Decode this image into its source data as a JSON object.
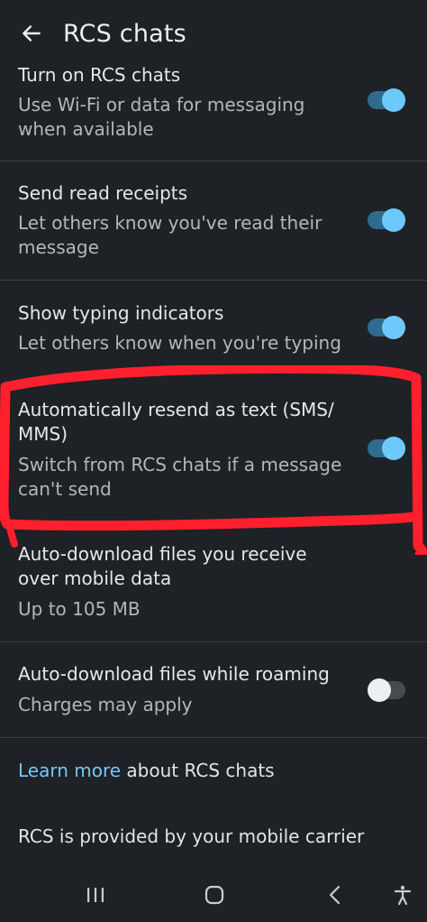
{
  "app_bar": {
    "title": "RCS chats",
    "back_icon": "arrow-back-icon"
  },
  "settings": [
    {
      "title": "Turn on RCS chats",
      "subtitle": "Use Wi-Fi or data for messaging when available",
      "toggle": "on"
    },
    {
      "title": "Send read receipts",
      "subtitle": "Let others know you've read their message",
      "toggle": "on"
    },
    {
      "title": "Show typing indicators",
      "subtitle": "Let others know when you're typing",
      "toggle": "on"
    },
    {
      "title": "Automatically resend as text (SMS/ MMS)",
      "subtitle": "Switch from RCS chats if a message can't send",
      "toggle": "on"
    },
    {
      "title": "Auto-download files you receive over mobile data",
      "subtitle": "Up to 105 MB"
    },
    {
      "title": "Auto-download files while roaming",
      "subtitle": "Charges may apply",
      "toggle": "off"
    }
  ],
  "footer": {
    "learn_more_link": "Learn more",
    "learn_more_rest": " about RCS chats",
    "carrier_note": "RCS is provided by your mobile carrier"
  },
  "colors": {
    "background": "#1e2125",
    "accent": "#6ec9fb",
    "highlight": "#ff1f2d"
  },
  "nav_bar": {
    "recents_icon": "recents-icon",
    "home_icon": "home-icon",
    "back_icon": "nav-back-icon",
    "accessibility_icon": "accessibility-icon"
  }
}
